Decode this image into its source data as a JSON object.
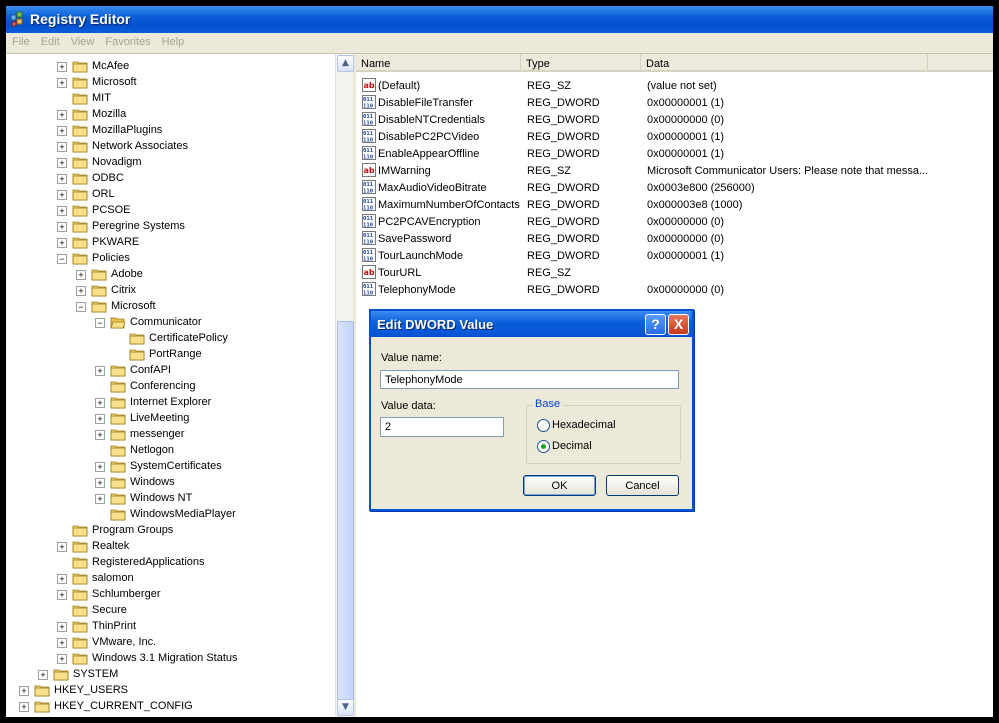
{
  "window": {
    "title": "Registry Editor"
  },
  "menu": [
    "File",
    "Edit",
    "View",
    "Favorites",
    "Help"
  ],
  "tree": [
    {
      "label": "McAfee",
      "level": 3,
      "expander": "+"
    },
    {
      "label": "Microsoft",
      "level": 3,
      "expander": "+"
    },
    {
      "label": "MIT",
      "level": 3,
      "expander": ""
    },
    {
      "label": "Mozilla",
      "level": 3,
      "expander": "+"
    },
    {
      "label": "MozillaPlugins",
      "level": 3,
      "expander": "+"
    },
    {
      "label": "Network Associates",
      "level": 3,
      "expander": "+"
    },
    {
      "label": "Novadigm",
      "level": 3,
      "expander": "+"
    },
    {
      "label": "ODBC",
      "level": 3,
      "expander": "+"
    },
    {
      "label": "ORL",
      "level": 3,
      "expander": "+"
    },
    {
      "label": "PCSOE",
      "level": 3,
      "expander": "+"
    },
    {
      "label": "Peregrine Systems",
      "level": 3,
      "expander": "+"
    },
    {
      "label": "PKWARE",
      "level": 3,
      "expander": "+"
    },
    {
      "label": "Policies",
      "level": 3,
      "expander": "-"
    },
    {
      "label": "Adobe",
      "level": 4,
      "expander": "+"
    },
    {
      "label": "Citrix",
      "level": 4,
      "expander": "+"
    },
    {
      "label": "Microsoft",
      "level": 4,
      "expander": "-"
    },
    {
      "label": "Communicator",
      "level": 5,
      "expander": "-",
      "open": true
    },
    {
      "label": "CertificatePolicy",
      "level": 6,
      "expander": ""
    },
    {
      "label": "PortRange",
      "level": 6,
      "expander": ""
    },
    {
      "label": "ConfAPI",
      "level": 5,
      "expander": "+"
    },
    {
      "label": "Conferencing",
      "level": 5,
      "expander": ""
    },
    {
      "label": "Internet Explorer",
      "level": 5,
      "expander": "+"
    },
    {
      "label": "LiveMeeting",
      "level": 5,
      "expander": "+"
    },
    {
      "label": "messenger",
      "level": 5,
      "expander": "+"
    },
    {
      "label": "Netlogon",
      "level": 5,
      "expander": ""
    },
    {
      "label": "SystemCertificates",
      "level": 5,
      "expander": "+"
    },
    {
      "label": "Windows",
      "level": 5,
      "expander": "+"
    },
    {
      "label": "Windows NT",
      "level": 5,
      "expander": "+"
    },
    {
      "label": "WindowsMediaPlayer",
      "level": 5,
      "expander": ""
    },
    {
      "label": "Program Groups",
      "level": 3,
      "expander": ""
    },
    {
      "label": "Realtek",
      "level": 3,
      "expander": "+"
    },
    {
      "label": "RegisteredApplications",
      "level": 3,
      "expander": ""
    },
    {
      "label": "salomon",
      "level": 3,
      "expander": "+"
    },
    {
      "label": "Schlumberger",
      "level": 3,
      "expander": "+"
    },
    {
      "label": "Secure",
      "level": 3,
      "expander": ""
    },
    {
      "label": "ThinPrint",
      "level": 3,
      "expander": "+"
    },
    {
      "label": "VMware, Inc.",
      "level": 3,
      "expander": "+"
    },
    {
      "label": "Windows 3.1 Migration Status",
      "level": 3,
      "expander": "+"
    },
    {
      "label": "SYSTEM",
      "level": 2,
      "expander": "+"
    },
    {
      "label": "HKEY_USERS",
      "level": 1,
      "expander": "+"
    },
    {
      "label": "HKEY_CURRENT_CONFIG",
      "level": 1,
      "expander": "+"
    }
  ],
  "columns": {
    "name": "Name",
    "type": "Type",
    "data": "Data"
  },
  "values": [
    {
      "name": "(Default)",
      "type": "REG_SZ",
      "data": "(value not set)",
      "icon": "string-value-icon"
    },
    {
      "name": "DisableFileTransfer",
      "type": "REG_DWORD",
      "data": "0x00000001 (1)",
      "icon": "binary-value-icon"
    },
    {
      "name": "DisableNTCredentials",
      "type": "REG_DWORD",
      "data": "0x00000000 (0)",
      "icon": "binary-value-icon"
    },
    {
      "name": "DisablePC2PCVideo",
      "type": "REG_DWORD",
      "data": "0x00000001 (1)",
      "icon": "binary-value-icon"
    },
    {
      "name": "EnableAppearOffline",
      "type": "REG_DWORD",
      "data": "0x00000001 (1)",
      "icon": "binary-value-icon"
    },
    {
      "name": "IMWarning",
      "type": "REG_SZ",
      "data": "Microsoft Communicator Users: Please note that messa...",
      "icon": "string-value-icon"
    },
    {
      "name": "MaxAudioVideoBitrate",
      "type": "REG_DWORD",
      "data": "0x0003e800 (256000)",
      "icon": "binary-value-icon"
    },
    {
      "name": "MaximumNumberOfContacts",
      "type": "REG_DWORD",
      "data": "0x000003e8 (1000)",
      "icon": "binary-value-icon"
    },
    {
      "name": "PC2PCAVEncryption",
      "type": "REG_DWORD",
      "data": "0x00000000 (0)",
      "icon": "binary-value-icon"
    },
    {
      "name": "SavePassword",
      "type": "REG_DWORD",
      "data": "0x00000000 (0)",
      "icon": "binary-value-icon"
    },
    {
      "name": "TourLaunchMode",
      "type": "REG_DWORD",
      "data": "0x00000001 (1)",
      "icon": "binary-value-icon"
    },
    {
      "name": "TourURL",
      "type": "REG_SZ",
      "data": "",
      "icon": "string-value-icon"
    },
    {
      "name": "TelephonyMode",
      "type": "REG_DWORD",
      "data": "0x00000000 (0)",
      "icon": "binary-value-icon"
    }
  ],
  "dialog": {
    "title": "Edit DWORD Value",
    "help": "?",
    "close": "X",
    "value_name_label": "Value name:",
    "value_name": "TelephonyMode",
    "value_data_label": "Value data:",
    "value_data": "2",
    "base_label": "Base",
    "hex_label": "Hexadecimal",
    "dec_label": "Decimal",
    "selected_base": "Decimal",
    "ok": "OK",
    "cancel": "Cancel"
  },
  "colors": {
    "titlebar": "#0a5fd8",
    "folder": "#f5d76e",
    "selection_accent": "#0046d5"
  }
}
